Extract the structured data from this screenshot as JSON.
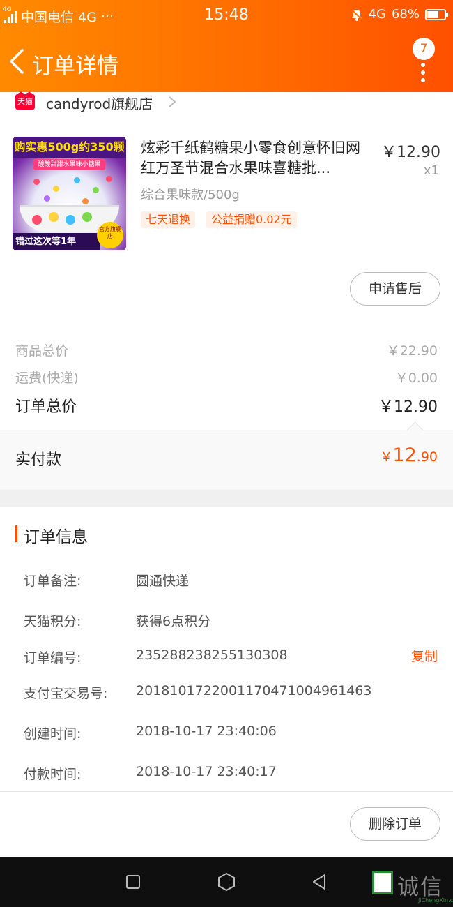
{
  "status_bar": {
    "network_small": "4G",
    "carrier": "中国电信 4G",
    "more": "···",
    "time": "15:48",
    "network": "4G",
    "battery": "68%",
    "battery_level": 0.68
  },
  "nav": {
    "title": "订单详情",
    "badge": "7"
  },
  "shop": {
    "platform_badge": "天猫",
    "name": "candyrod旗舰店"
  },
  "product": {
    "image_banner": "购实惠500g约350颗",
    "image_subbanner": "酸酸甜甜水果味小糖果",
    "image_footer": "错过这次等1年",
    "image_seal": "官方旗舰店",
    "title": "炫彩千纸鹤糖果小零食创意怀旧网红万圣节混合水果味喜糖批...",
    "price": "￥12.90",
    "quantity": "x1",
    "spec": "综合果味款/500g",
    "tags": [
      "七天退换",
      "公益捐赠0.02元"
    ],
    "after_sale_button": "申请售后"
  },
  "totals": {
    "goods_label": "商品总价",
    "goods_value": "￥22.90",
    "shipping_label": "运费(快递)",
    "shipping_value": "￥0.00",
    "order_total_label": "订单总价",
    "order_total_value": "￥12.90",
    "paid_label": "实付款",
    "paid_symbol": "￥",
    "paid_int": "12",
    "paid_dec": ".90"
  },
  "order_info": {
    "title": "订单信息",
    "rows": [
      {
        "key": "订单备注:",
        "value": "圆通快递"
      },
      {
        "key": "天猫积分:",
        "value": "获得6点积分"
      },
      {
        "key": "订单编号:",
        "value": "235288238255130308"
      },
      {
        "key": "支付宝交易号:",
        "value": "2018101722001170471004961463"
      },
      {
        "key": "创建时间:",
        "value": "2018-10-17 23:40:06"
      },
      {
        "key": "付款时间:",
        "value": "2018-10-17 23:40:17"
      }
    ],
    "copy_label": "复制",
    "delete_button": "删除订单"
  },
  "watermark": {
    "text": "诚信",
    "url_text": "JiChengXin.com"
  }
}
